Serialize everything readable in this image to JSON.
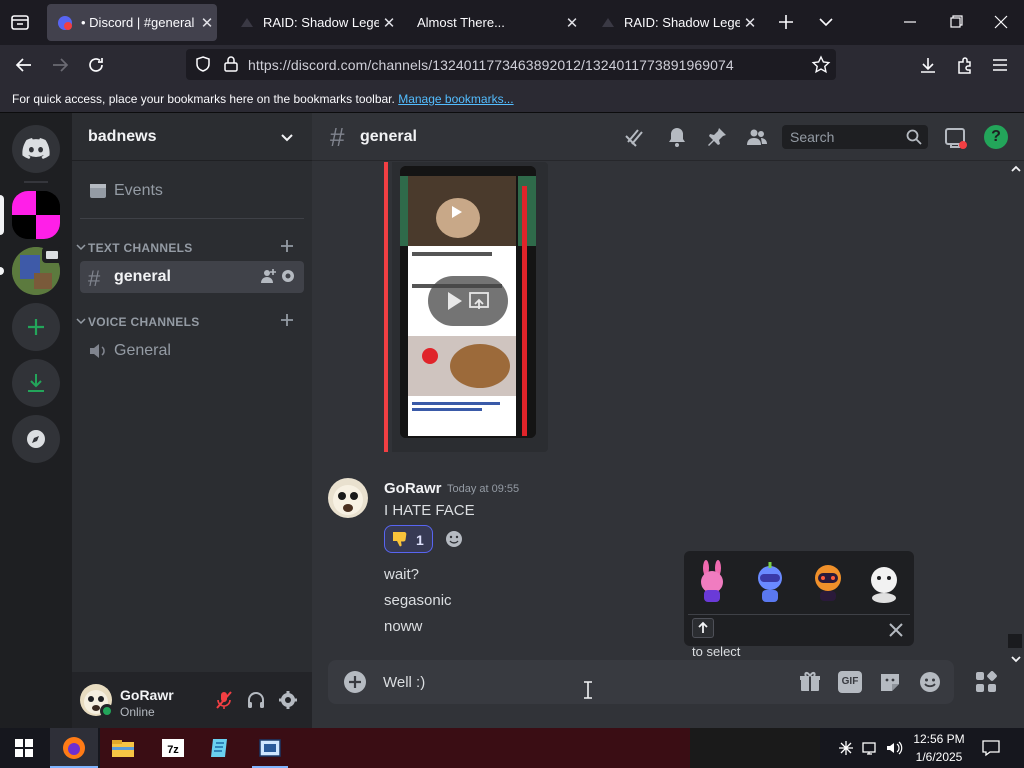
{
  "browser": {
    "tabs": [
      {
        "title": "• Discord | #general | b",
        "active": true
      },
      {
        "title": "RAID: Shadow Legends",
        "active": false
      },
      {
        "title": "Almost There...",
        "active": false
      },
      {
        "title": "RAID: Shadow Legends",
        "active": false
      }
    ],
    "url": "https://discord.com/channels/1324011773463892012/1324011773891969074",
    "bookmarks_text": "For quick access, place your bookmarks here on the bookmarks toolbar.",
    "bookmarks_link": "Manage bookmarks..."
  },
  "server": {
    "name": "badnews",
    "events_label": "Events",
    "text_category": "TEXT CHANNELS",
    "text_channel": "general",
    "voice_category": "VOICE CHANNELS",
    "voice_channel": "General"
  },
  "chat": {
    "channel_name": "general",
    "search_placeholder": "Search",
    "message": {
      "author": "GoRawr",
      "timestamp": "Today at 09:55",
      "text": "I HATE FACE",
      "reaction_count": "1",
      "followups": [
        "wait?",
        "segasonic",
        "noww"
      ]
    },
    "composer_text": "Well :)",
    "picker_hint": "to select"
  },
  "user": {
    "name": "GoRawr",
    "status": "Online"
  },
  "taskbar": {
    "time": "12:56 PM",
    "date": "1/6/2025"
  },
  "colors": {
    "accent": "#5865f2",
    "online": "#23a55a",
    "mute_red": "#f23f43",
    "link": "#53bdff"
  }
}
